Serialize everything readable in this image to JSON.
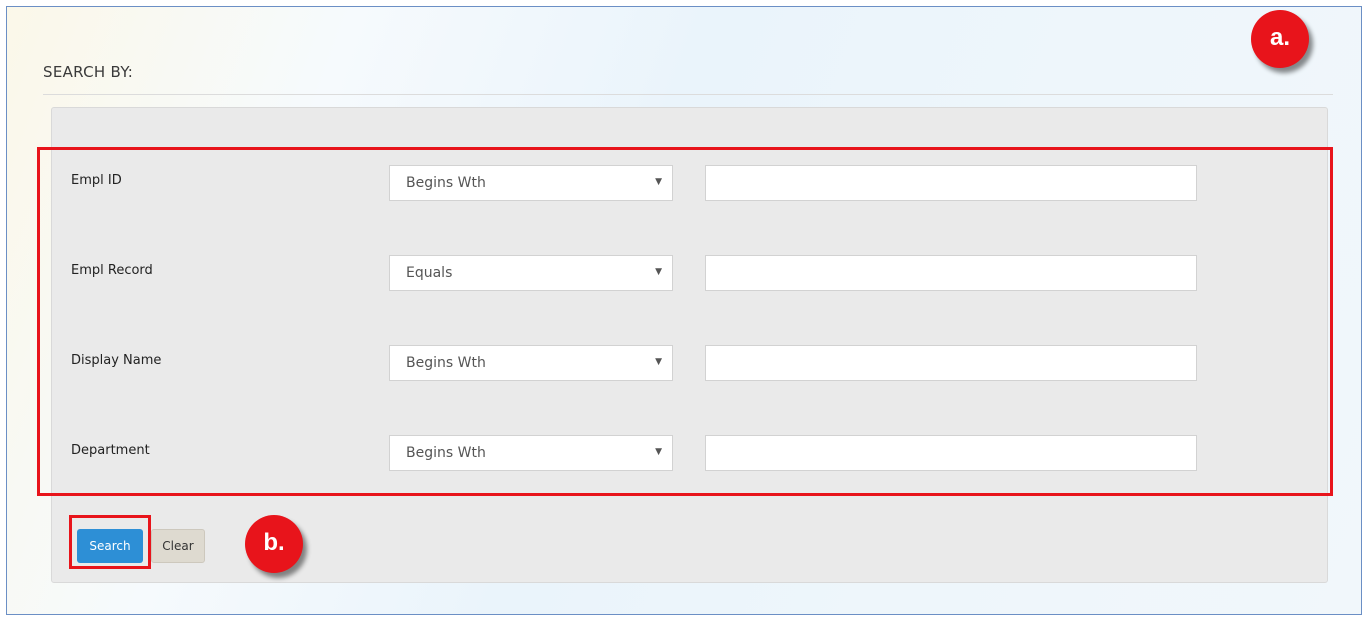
{
  "section": {
    "title": "SEARCH BY:"
  },
  "criteria": [
    {
      "label": "Empl ID",
      "operator": "Begins Wth",
      "value": ""
    },
    {
      "label": "Empl Record",
      "operator": "Equals",
      "value": ""
    },
    {
      "label": "Display Name",
      "operator": "Begins Wth",
      "value": ""
    },
    {
      "label": "Department",
      "operator": "Begins Wth",
      "value": ""
    }
  ],
  "buttons": {
    "search_label": "Search",
    "clear_label": "Clear"
  },
  "callouts": {
    "a": "a.",
    "b": "b."
  },
  "colors": {
    "highlight": "#e8141b",
    "search_button": "#2d8fd6",
    "frame_border": "#6b8fc5"
  }
}
